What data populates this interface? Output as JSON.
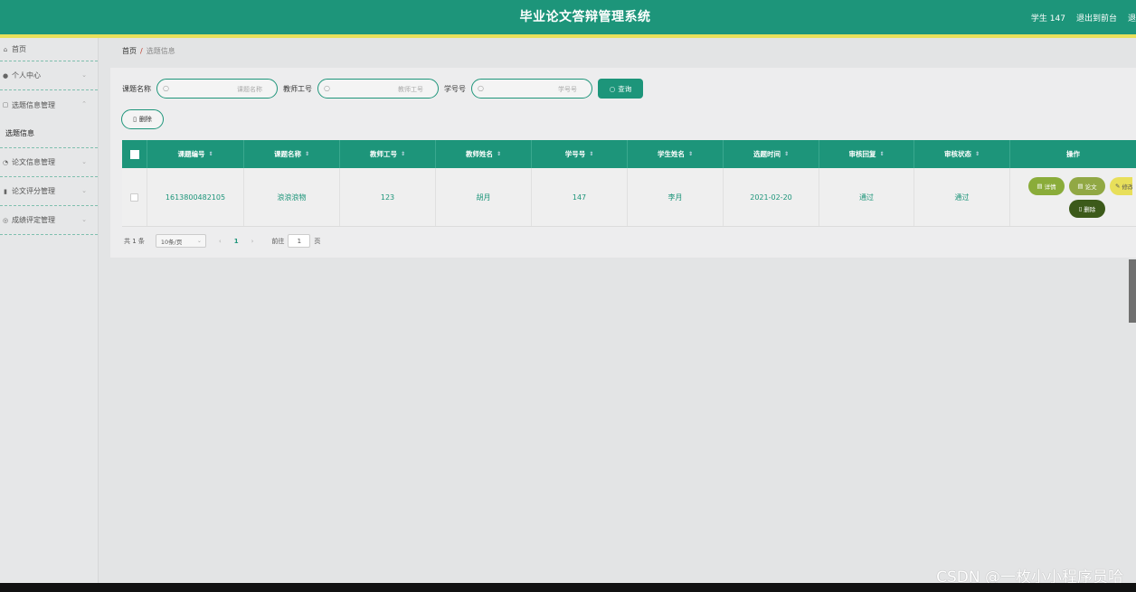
{
  "header": {
    "title": "毕业论文答辩管理系统",
    "user": "学生 147",
    "back_to_front": "退出到前台",
    "logout": "退"
  },
  "sidebar": {
    "items": [
      {
        "label": "首页",
        "icon": "home-icon"
      },
      {
        "label": "个人中心",
        "icon": "user-icon"
      },
      {
        "label": "选题信息管理",
        "icon": "list-icon",
        "expanded": true,
        "children": [
          {
            "label": "选题信息"
          }
        ]
      },
      {
        "label": "论文信息管理",
        "icon": "doc-icon"
      },
      {
        "label": "论文评分管理",
        "icon": "score-icon"
      },
      {
        "label": "成绩评定管理",
        "icon": "grade-icon"
      }
    ]
  },
  "breadcrumb": {
    "home": "首页",
    "sep": "/",
    "current": "选题信息"
  },
  "search": {
    "topic_label": "课题名称",
    "topic_placeholder": "课题名称",
    "teacher_label": "教师工号",
    "teacher_placeholder": "教师工号",
    "student_label": "学号号",
    "student_placeholder": "学号号",
    "query_button": "查询"
  },
  "delete_button": "删除",
  "table": {
    "columns": [
      "课题编号",
      "课题名称",
      "教师工号",
      "教师姓名",
      "学号号",
      "学生姓名",
      "选题时间",
      "审核回复",
      "审核状态",
      "操作"
    ],
    "rows": [
      {
        "code": "1613800482105",
        "name": "浪浪浪物",
        "teacher_id": "123",
        "teacher_name": "胡月",
        "student_id": "147",
        "student_name": "李月",
        "time": "2021-02-20",
        "reply": "通过",
        "status": "通过"
      }
    ],
    "actions": {
      "detail": "详情",
      "paper": "论文",
      "edit": "修改",
      "delete": "删除"
    }
  },
  "pagination": {
    "total": "共 1 条",
    "page_size": "10条/页",
    "current": "1",
    "goto_prefix": "前往",
    "goto_value": "1",
    "goto_suffix": "页"
  },
  "watermark": "CSDN @一枚小小程序员哈",
  "colors": {
    "primary": "#1d957a",
    "accent_line": "#e8e05a",
    "edit": "#e8df5a",
    "delete": "#3c5a1a"
  }
}
